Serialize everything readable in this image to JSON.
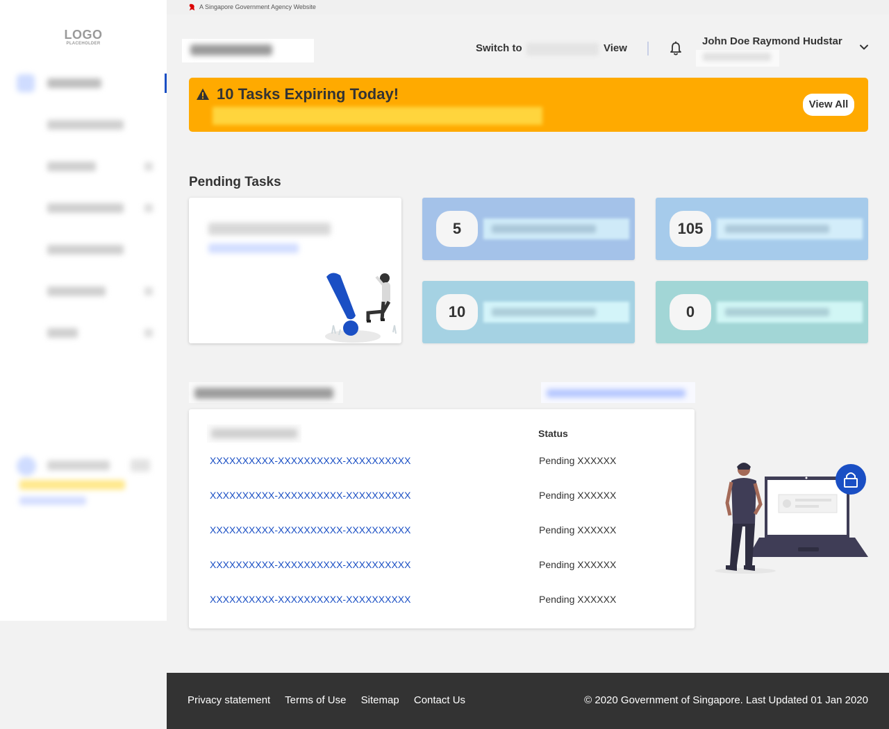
{
  "sidebar": {
    "logo_main": "LOGO",
    "logo_sub": "PLACEHOLDER"
  },
  "gov_banner": {
    "text": "A Singapore Government Agency Website"
  },
  "header": {
    "switch_prefix": "Switch to",
    "switch_suffix": "View",
    "user_name": "John Doe Raymond Hudstar"
  },
  "alert": {
    "title": "10 Tasks Expiring Today!",
    "button_label": "View All",
    "color": "#ffaa00"
  },
  "pending": {
    "title": "Pending Tasks",
    "tiles": [
      {
        "count": "5",
        "color": "#a4c2e9",
        "label_color": "#d7f2fb"
      },
      {
        "count": "105",
        "color": "#a6cbeb",
        "label_color": "#dcf4fd"
      },
      {
        "count": "10",
        "color": "#a5d2e3",
        "label_color": "#dcfafe"
      },
      {
        "count": "0",
        "color": "#a2d6d6",
        "label_color": "#dafcfb"
      }
    ]
  },
  "table": {
    "status_header": "Status",
    "rows": [
      {
        "id": "XXXXXXXXXX-XXXXXXXXXX-XXXXXXXXXX",
        "status": "Pending XXXXXX"
      },
      {
        "id": "XXXXXXXXXX-XXXXXXXXXX-XXXXXXXXXX",
        "status": "Pending XXXXXX"
      },
      {
        "id": "XXXXXXXXXX-XXXXXXXXXX-XXXXXXXXXX",
        "status": "Pending XXXXXX"
      },
      {
        "id": "XXXXXXXXXX-XXXXXXXXXX-XXXXXXXXXX",
        "status": "Pending XXXXXX"
      },
      {
        "id": "XXXXXXXXXX-XXXXXXXXXX-XXXXXXXXXX",
        "status": "Pending XXXXXX"
      }
    ]
  },
  "footer": {
    "links": [
      "Privacy statement",
      "Terms of Use",
      "Sitemap",
      "Contact Us"
    ],
    "copyright": "© 2020 Government of Singapore. Last Updated 01 Jan 2020"
  },
  "colors": {
    "accent": "#1a4fc4",
    "footer_bg": "#333333"
  }
}
